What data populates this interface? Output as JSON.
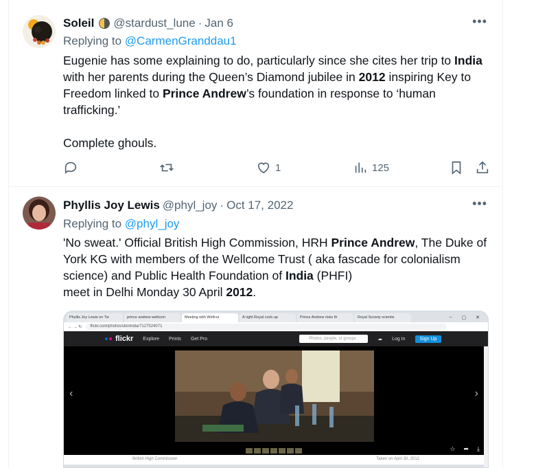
{
  "tweets": [
    {
      "display_name": "Soleil",
      "handle": "@stardust_lune",
      "date": "Jan 6",
      "replying_label": "Replying to",
      "replying_to": "@CarmenGranddau1",
      "body_parts": [
        "Eugenie has some explaining to do, particularly since she cites her trip to ",
        "India",
        " with her parents during the Queen’s Diamond jubilee in ",
        "2012",
        " inspiring Key to Freedom linked to ",
        "Prince Andrew",
        "’s foundation in response to ‘human trafficking.’",
        "Complete ghouls."
      ],
      "stats": {
        "replies": "",
        "retweets": "",
        "likes": "1",
        "views": "125"
      }
    },
    {
      "display_name": "Phyllis Joy Lewis",
      "handle": "@phyl_joy",
      "date": "Oct 17, 2022",
      "replying_label": "Replying to",
      "replying_to": "@phyl_joy",
      "body_parts": [
        "'No sweat.' Official British High Commission, HRH ",
        "Prince Andrew",
        ", The Duke of York KG with members of the Wellcome Trust ( aka fascade for colonialism science) and Public Health Foundation of ",
        "India",
        " (PHFI)",
        " meet in Delhi Monday 30 April ",
        "2012",
        "."
      ],
      "media": {
        "browser_tabs": [
          "Phyllis Joy Lewis on Tw",
          "prince andrew wellcom",
          "Meeting with Wellcor",
          "A right Royal cock-up",
          "Prince Andrew risks th",
          "Royal Society scientis"
        ],
        "url": "flickr.com/photos/ukinindia/7127524071",
        "site_logo": "flickr",
        "nav": [
          "Explore",
          "Prints",
          "Get Pro"
        ],
        "search_placeholder": "Photos, people, or groups",
        "login": "Log In",
        "signup": "Sign Up",
        "caption_left": "British High Commission",
        "caption_right": "Taken on April 30, 2012"
      }
    }
  ],
  "more_icon": "more-horizontal-icon",
  "colors": {
    "link": "#1d9bf0",
    "muted": "#536471",
    "text": "#0f1419",
    "border": "#eff3f4"
  }
}
